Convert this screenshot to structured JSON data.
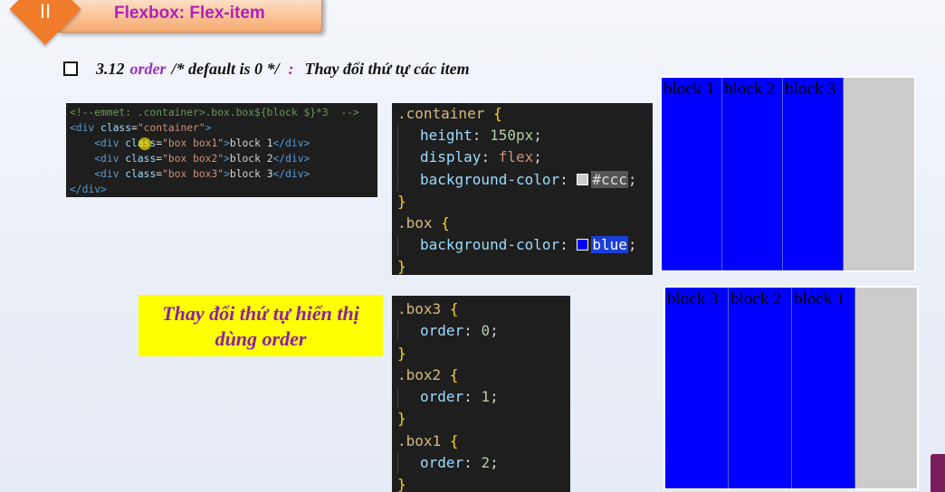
{
  "header": {
    "number": "II",
    "title": "Flexbox: Flex-item"
  },
  "section": {
    "number": "3.12",
    "keyword": "order",
    "comment": "/* default is 0 */",
    "colon": ":",
    "description": "Thay đổi thứ tự các item"
  },
  "html_code": {
    "lines": [
      "<!--emmet: .container>.box.box${block $}*3  -->",
      "<div class=\"container\">",
      "    <div class=\"box box1\">block 1</div>",
      "    <div class=\"box box2\">block 2</div>",
      "    <div class=\"box box3\">block 3</div>",
      "</div>"
    ]
  },
  "css_code_1": {
    "container_selector": ".container",
    "height_prop": "height",
    "height_val": "150px",
    "display_prop": "display",
    "display_val": "flex",
    "bg_prop": "background-color",
    "bg_val": "#ccc",
    "box_selector": ".box",
    "box_bg_prop": "background-color",
    "box_bg_val": "blue"
  },
  "css_code_2": {
    "rules": [
      {
        "selector": ".box3",
        "prop": "order",
        "value": "0"
      },
      {
        "selector": ".box2",
        "prop": "order",
        "value": "1"
      },
      {
        "selector": ".box1",
        "prop": "order",
        "value": "2"
      }
    ]
  },
  "demo1": {
    "boxes": [
      "block 1",
      "block 2",
      "block 3"
    ]
  },
  "demo2": {
    "boxes": [
      "block 3",
      "block 2",
      "block 1"
    ]
  },
  "note": {
    "line1": "Thay đổi thứ tự hiển thị",
    "line2": "dùng order"
  },
  "colors": {
    "accent_orange": "#f07b2a",
    "title_purple": "#b21fb8",
    "box_blue": "#0000ff",
    "container_gray": "#cccccc",
    "note_yellow": "#ffff00"
  }
}
